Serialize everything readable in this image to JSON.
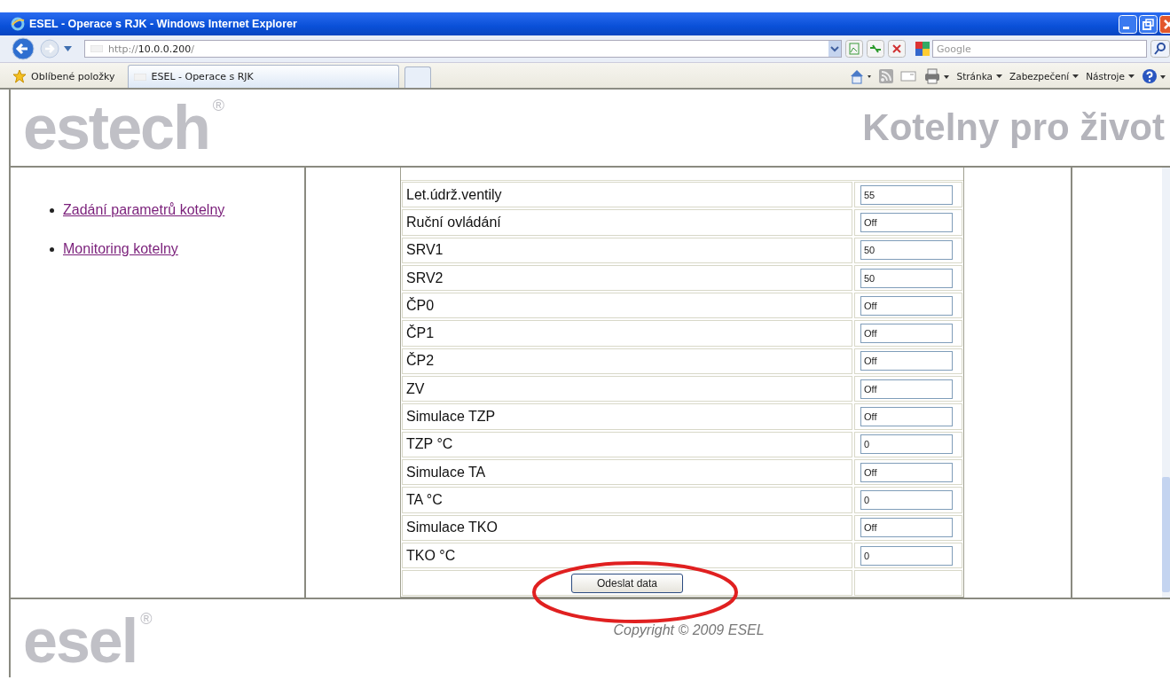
{
  "window": {
    "title": "ESEL - Operace s RJK - Windows Internet Explorer"
  },
  "address_bar": {
    "prefix": "http://",
    "host": "10.0.0.200",
    "suffix": "/"
  },
  "search": {
    "placeholder": "Google"
  },
  "favorites": {
    "label": "Oblíbené položky"
  },
  "tabs": [
    {
      "label": "ESEL - Operace s RJK",
      "selected": true
    }
  ],
  "command_bar": [
    "Stránka",
    "Zabezpečení",
    "Nástroje"
  ],
  "header": {
    "logo": "estech",
    "logo_mark": "®",
    "slogan": "Kotelny pro život"
  },
  "sidebar": {
    "items": [
      {
        "label": "Zadání parametrů kotelny"
      },
      {
        "label": "Monitoring kotelny"
      }
    ]
  },
  "form": {
    "rows": [
      {
        "label": "Let.údrž.ventily",
        "value": "55"
      },
      {
        "label": "Ruční ovládání",
        "value": "Off"
      },
      {
        "label": "SRV1",
        "value": "50"
      },
      {
        "label": "SRV2",
        "value": "50"
      },
      {
        "label": "ČP0",
        "value": "Off"
      },
      {
        "label": "ČP1",
        "value": "Off"
      },
      {
        "label": "ČP2",
        "value": "Off"
      },
      {
        "label": "ZV",
        "value": "Off"
      },
      {
        "label": "Simulace TZP",
        "value": "Off"
      },
      {
        "label": "TZP °C",
        "value": "0"
      },
      {
        "label": "Simulace TA",
        "value": "Off"
      },
      {
        "label": "TA °C",
        "value": "0"
      },
      {
        "label": "Simulace TKO",
        "value": "Off"
      },
      {
        "label": "TKO °C",
        "value": "0"
      }
    ],
    "submit": {
      "label": "Odeslat data",
      "circled": true
    }
  },
  "footer": {
    "logo": "esel",
    "logo_mark": "®",
    "copyright": "Copyright © 2009 ESEL"
  }
}
